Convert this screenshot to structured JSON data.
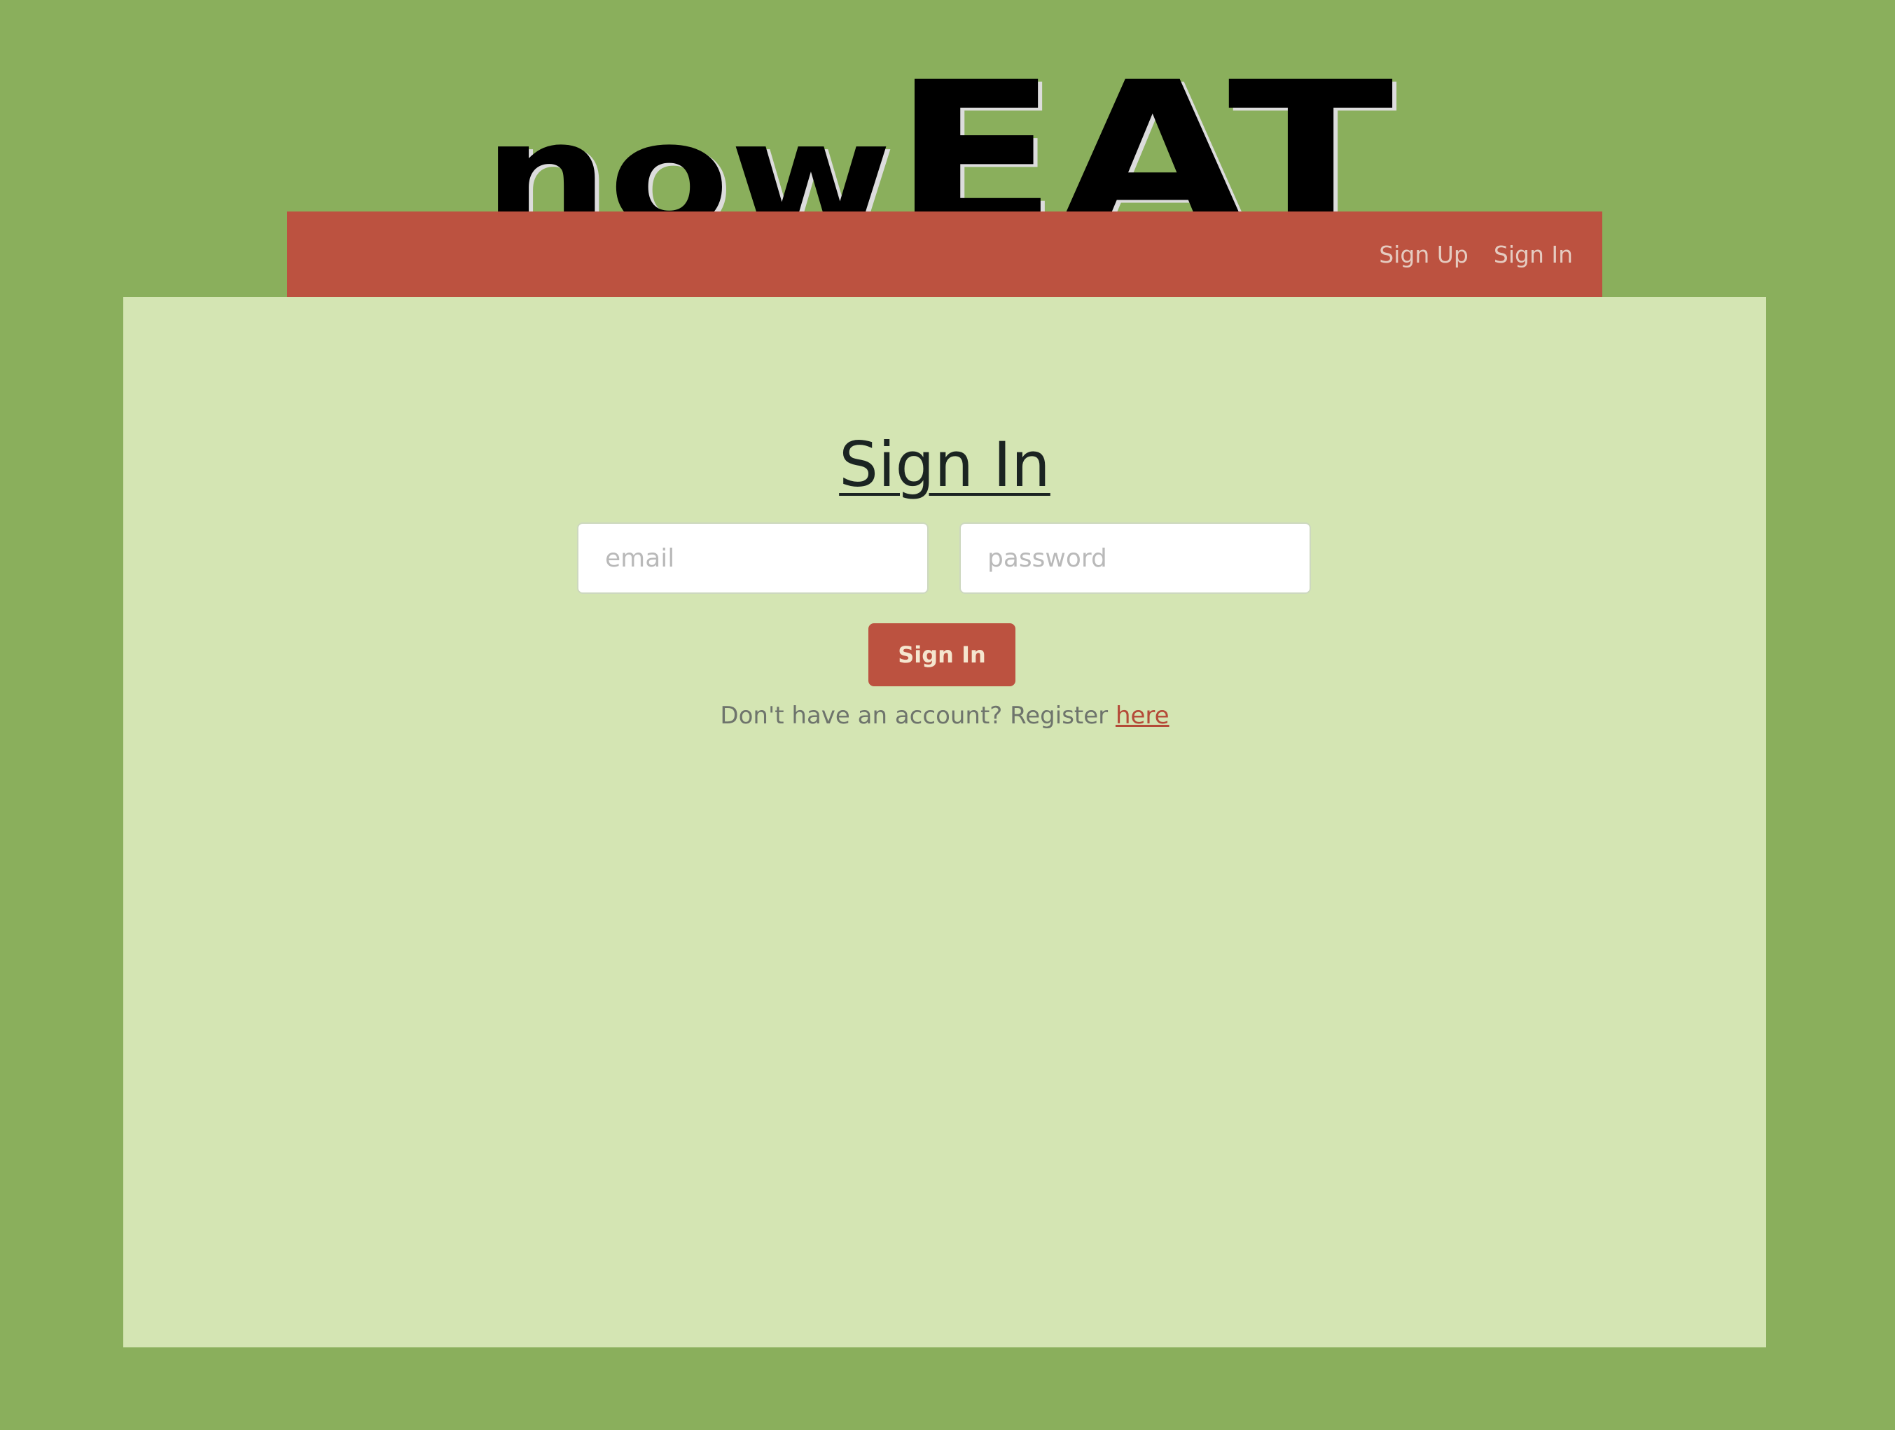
{
  "logo": {
    "part1": "now",
    "part2": "EAT"
  },
  "nav": {
    "items": [
      {
        "label": "Sign Up"
      },
      {
        "label": "Sign In"
      }
    ]
  },
  "form": {
    "title": "Sign In",
    "email_placeholder": "email",
    "password_placeholder": "password",
    "submit_label": "Sign In",
    "register_prompt": "Don't have an account? Register ",
    "register_link": "here"
  },
  "colors": {
    "page_background": "#8aaf5c",
    "navbar": "#bc5240",
    "panel": "#d4e5b3",
    "button": "#bc5240",
    "link": "#b44a38"
  }
}
